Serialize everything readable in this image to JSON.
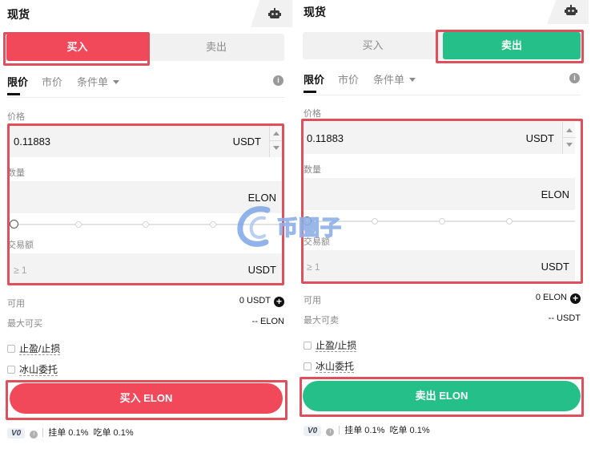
{
  "colors": {
    "buy": "#f2495a",
    "sell": "#25c08a",
    "highlight": "#e0505c"
  },
  "icons": {
    "robot": "robot-icon",
    "info": "info-icon",
    "plus": "plus-circle-icon",
    "watermark": "logo-watermark"
  },
  "watermark_text": "币圈子",
  "left": {
    "title": "现货",
    "buy_tab": "买入",
    "sell_tab": "卖出",
    "active_side": "buy",
    "order_tabs": {
      "limit": "限价",
      "market": "市价",
      "conditional": "条件单"
    },
    "price_label": "价格",
    "price_value": "0.11883",
    "price_unit": "USDT",
    "amount_label": "数量",
    "amount_unit": "ELON",
    "total_label": "交易额",
    "total_placeholder": "≥ 1",
    "total_unit": "USDT",
    "available_label": "可用",
    "available_value": "0 USDT",
    "max_label": "最大可买",
    "max_value": "-- ELON",
    "tp_sl": "止盈/止损",
    "iceberg": "冰山委托",
    "submit": "买入 ELON",
    "vip": "V0",
    "maker_fee": "挂单 0.1%",
    "taker_fee": "吃单 0.1%"
  },
  "right": {
    "title": "现货",
    "buy_tab": "买入",
    "sell_tab": "卖出",
    "active_side": "sell",
    "order_tabs": {
      "limit": "限价",
      "market": "市价",
      "conditional": "条件单"
    },
    "price_label": "价格",
    "price_value": "0.11883",
    "price_unit": "USDT",
    "amount_label": "数量",
    "amount_unit": "ELON",
    "total_label": "交易额",
    "total_placeholder": "≥ 1",
    "total_unit": "USDT",
    "available_label": "可用",
    "available_value": "0 ELON",
    "max_label": "最大可卖",
    "max_value": "-- USDT",
    "tp_sl": "止盈/止损",
    "iceberg": "冰山委托",
    "submit": "卖出 ELON",
    "vip": "V0",
    "maker_fee": "挂单 0.1%",
    "taker_fee": "吃单 0.1%"
  }
}
